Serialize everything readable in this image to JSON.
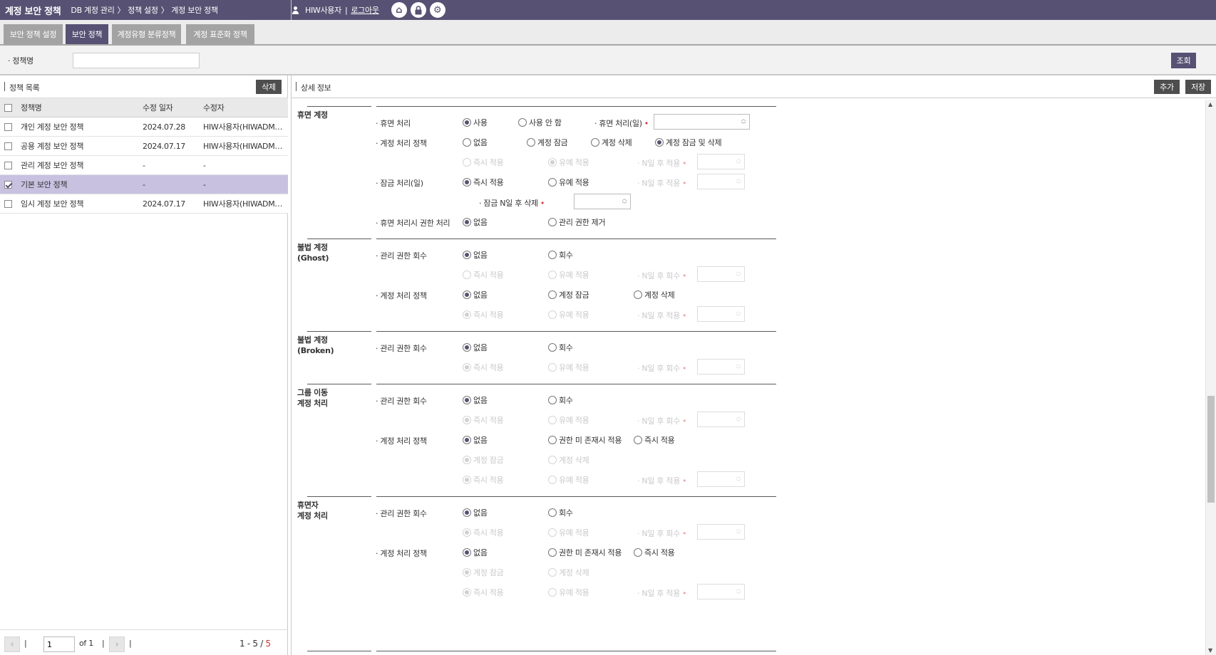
{
  "header": {
    "title": "계정 보안 정책",
    "breadcrumb": [
      "DB 계정 관리",
      "〉",
      "정책 설정",
      "〉",
      "계정 보안 정책"
    ],
    "user": "HIW사용자",
    "separator": "|",
    "logout": "로그아웃",
    "icons": [
      "home-icon",
      "lock-icon",
      "gear-icon"
    ]
  },
  "tabs": [
    {
      "label": "보안 정책 설정"
    },
    {
      "label": "보안 정책"
    },
    {
      "label": "계정유형 분류정책"
    },
    {
      "label": "계정 표준화 정책"
    }
  ],
  "search": {
    "label": "정책명",
    "value": "",
    "button": "조회"
  },
  "list_panel": {
    "title": "정책 목록",
    "delete": "삭제",
    "columns": [
      "정책명",
      "수정 일자",
      "수정자"
    ],
    "rows": [
      {
        "name": "개인 계정 보안 정책",
        "date": "2024.07.28",
        "user": "HIW사용자(HIWADM…",
        "checked": false
      },
      {
        "name": "공용 계정 보안 정책",
        "date": "2024.07.17",
        "user": "HIW사용자(HIWADM…",
        "checked": false
      },
      {
        "name": "관리 계정 보안 정책",
        "date": "-",
        "user": "-",
        "checked": false
      },
      {
        "name": "기본 보안 정책",
        "date": "-",
        "user": "-",
        "checked": true
      },
      {
        "name": "임시 계정 보안 정책",
        "date": "2024.07.17",
        "user": "HIW사용자(HIWADM…",
        "checked": false
      }
    ],
    "pager": {
      "page": "1",
      "of": "of 1",
      "sep": "|",
      "range": "1 - 5",
      "slash": "/",
      "total": "5"
    }
  },
  "detail": {
    "title": "상세 정보",
    "add": "추가",
    "save": "저장",
    "sections": [
      {
        "title1": "휴면 계정",
        "title2": "",
        "rows": [
          {
            "label": "휴면 처리",
            "options": [
              {
                "t": "사용",
                "on": true
              },
              {
                "t": "사용 안 함",
                "on": false
              }
            ],
            "extra_label": "휴면 처리(일)",
            "extra_dis": false
          },
          {
            "label": "계정 처리 정책",
            "options": [
              {
                "t": "없음",
                "on": false
              },
              {
                "t": "계정 잠금",
                "on": false
              },
              {
                "t": "계정 삭제",
                "on": false
              },
              {
                "t": "계정 잠금 및 삭제",
                "on": true
              }
            ]
          },
          {
            "label": "",
            "dis": true,
            "options": [
              {
                "t": "즉시 적용",
                "on": false
              },
              {
                "t": "유예 적용",
                "on": true
              }
            ],
            "extra_label": "N일 후 적용",
            "extra_dis": true
          },
          {
            "label": "잠금 처리(일)",
            "options": [
              {
                "t": "즉시 적용",
                "on": true
              },
              {
                "t": "유예 적용",
                "on": false
              }
            ],
            "extra_label": "N일 후 적용",
            "extra_dis": true
          },
          {
            "label": "",
            "sub_label": "잠금 N일 후 삭제"
          },
          {
            "label": "휴면 처리시 권한 처리",
            "options": [
              {
                "t": "없음",
                "on": true
              },
              {
                "t": "관리 권한 제거",
                "on": false
              }
            ]
          }
        ]
      },
      {
        "title1": "불법 계정",
        "title2": "(Ghost)",
        "rows": [
          {
            "label": "관리 권한 회수",
            "options": [
              {
                "t": "없음",
                "on": true
              },
              {
                "t": "회수",
                "on": false
              }
            ]
          },
          {
            "label": "",
            "dis": true,
            "options": [
              {
                "t": "즉시 적용",
                "on": false
              },
              {
                "t": "유예 적용",
                "on": false
              }
            ],
            "extra_label": "N일 후 회수",
            "extra_dis": true
          },
          {
            "label": "계정 처리 정책",
            "options": [
              {
                "t": "없음",
                "on": true
              },
              {
                "t": "계정 잠금",
                "on": false
              },
              {
                "t": "계정 삭제",
                "on": false
              }
            ]
          },
          {
            "label": "",
            "dis": true,
            "options": [
              {
                "t": "즉시 적용",
                "on": true
              },
              {
                "t": "유예 적용",
                "on": false
              }
            ],
            "extra_label": "N일 후 적용",
            "extra_dis": true
          }
        ]
      },
      {
        "title1": "불법 계정",
        "title2": "(Broken)",
        "rows": [
          {
            "label": "관리 권한 회수",
            "options": [
              {
                "t": "없음",
                "on": true
              },
              {
                "t": "회수",
                "on": false
              }
            ]
          },
          {
            "label": "",
            "dis": true,
            "options": [
              {
                "t": "즉시 적용",
                "on": true
              },
              {
                "t": "유예 적용",
                "on": false
              }
            ],
            "extra_label": "N일 후 회수",
            "extra_dis": true
          }
        ]
      },
      {
        "title1": "그룹 이동",
        "title2": "계정 처리",
        "rows": [
          {
            "label": "관리 권한 회수",
            "options": [
              {
                "t": "없음",
                "on": true
              },
              {
                "t": "회수",
                "on": false
              }
            ]
          },
          {
            "label": "",
            "dis": true,
            "options": [
              {
                "t": "즉시 적용",
                "on": true
              },
              {
                "t": "유예 적용",
                "on": false
              }
            ],
            "extra_label": "N일 후 회수",
            "extra_dis": true
          },
          {
            "label": "계정 처리 정책",
            "options": [
              {
                "t": "없음",
                "on": true
              },
              {
                "t": "권한 미 존재시 적용",
                "on": false
              },
              {
                "t": "즉시 적용",
                "on": false
              }
            ]
          },
          {
            "label": "",
            "dis": true,
            "options": [
              {
                "t": "계정 잠금",
                "on": true
              },
              {
                "t": "계정 삭제",
                "on": false
              }
            ]
          },
          {
            "label": "",
            "dis": true,
            "options": [
              {
                "t": "즉시 적용",
                "on": true
              },
              {
                "t": "유예 적용",
                "on": false
              }
            ],
            "extra_label": "N일 후 적용",
            "extra_dis": true
          }
        ]
      },
      {
        "title1": "휴면자",
        "title2": "계정 처리",
        "rows": [
          {
            "label": "관리 권한 회수",
            "options": [
              {
                "t": "없음",
                "on": true
              },
              {
                "t": "회수",
                "on": false
              }
            ]
          },
          {
            "label": "",
            "dis": true,
            "options": [
              {
                "t": "즉시 적용",
                "on": true
              },
              {
                "t": "유예 적용",
                "on": false
              }
            ],
            "extra_label": "N일 후 회수",
            "extra_dis": true
          },
          {
            "label": "계정 처리 정책",
            "options": [
              {
                "t": "없음",
                "on": true
              },
              {
                "t": "권한 미 존재시 적용",
                "on": false
              },
              {
                "t": "즉시 적용",
                "on": false
              }
            ]
          },
          {
            "label": "",
            "dis": true,
            "options": [
              {
                "t": "계정 잠금",
                "on": true
              },
              {
                "t": "계정 삭제",
                "on": false
              }
            ]
          },
          {
            "label": "",
            "dis": true,
            "options": [
              {
                "t": "즉시 적용",
                "on": true
              },
              {
                "t": "유예 적용",
                "on": false
              }
            ],
            "extra_label": "N일 후 적용",
            "extra_dis": true
          }
        ]
      }
    ]
  },
  "colors": {
    "accent": "#575173",
    "selected_row": "#c8c1e0",
    "required": "#d0343a"
  }
}
